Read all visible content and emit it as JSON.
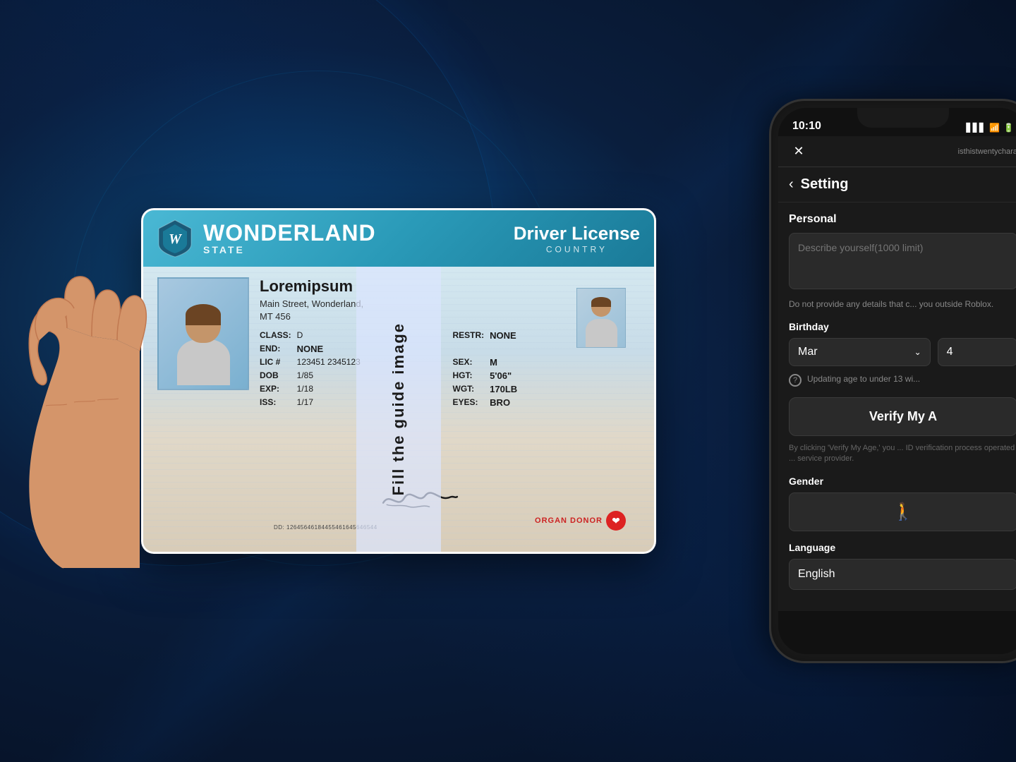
{
  "background": {
    "color": "#0a1628"
  },
  "id_card": {
    "header": {
      "shield_letter": "W",
      "main_title": "WONDERLAND",
      "subtitle": "STATE",
      "right_title": "Driver License",
      "country": "COUNTRY"
    },
    "person": {
      "name": "Loremipsum",
      "address_line1": "Main Street, Wonderland,",
      "address_line2": "MT 456"
    },
    "fields": {
      "class_label": "CLASS:",
      "class_value": "D",
      "restr_label": "RESTR:",
      "restr_value": "NONE",
      "end_label": "END:",
      "end_value": "NONE",
      "lic_label": "LIC #",
      "lic_value": "123451 2345123",
      "sex_label": "SEX:",
      "sex_value": "M",
      "dob_label": "DOB",
      "dob_value": "1/85",
      "hgt_label": "HGT:",
      "hgt_value": "5'06\"",
      "exp_label": "EXP:",
      "exp_value": "1/18",
      "wgt_label": "WGT:",
      "wgt_value": "170LB",
      "iss_label": "ISS:",
      "iss_value": "1/17",
      "eyes_label": "EYES:",
      "eyes_value": "BRO"
    },
    "barcode": "DD: 12645646184455461645646544",
    "organ_donor": "ORGAN DONOR"
  },
  "guide_overlay": {
    "text": "Fill the guide image"
  },
  "phone": {
    "status_bar": {
      "time": "10:10"
    },
    "app_header": {
      "close_label": "✕",
      "username": "isthistwentychara"
    },
    "settings": {
      "back_label": "‹",
      "title": "Setting",
      "personal_label": "Personal",
      "describe_placeholder": "Describe yourself(1000 limit)",
      "warning_text": "Do not provide any details that c... you outside Roblox.",
      "birthday_label": "Birthday",
      "month_value": "Mar",
      "day_value": "4",
      "age_warning": "Updating age to under 13 wi...",
      "verify_btn_label": "Verify My A",
      "verify_disclaimer": "By clicking 'Verify My Age,' you ... ID verification process operated ... service provider.",
      "gender_label": "Gender",
      "language_label": "Language",
      "language_value": "English"
    }
  }
}
